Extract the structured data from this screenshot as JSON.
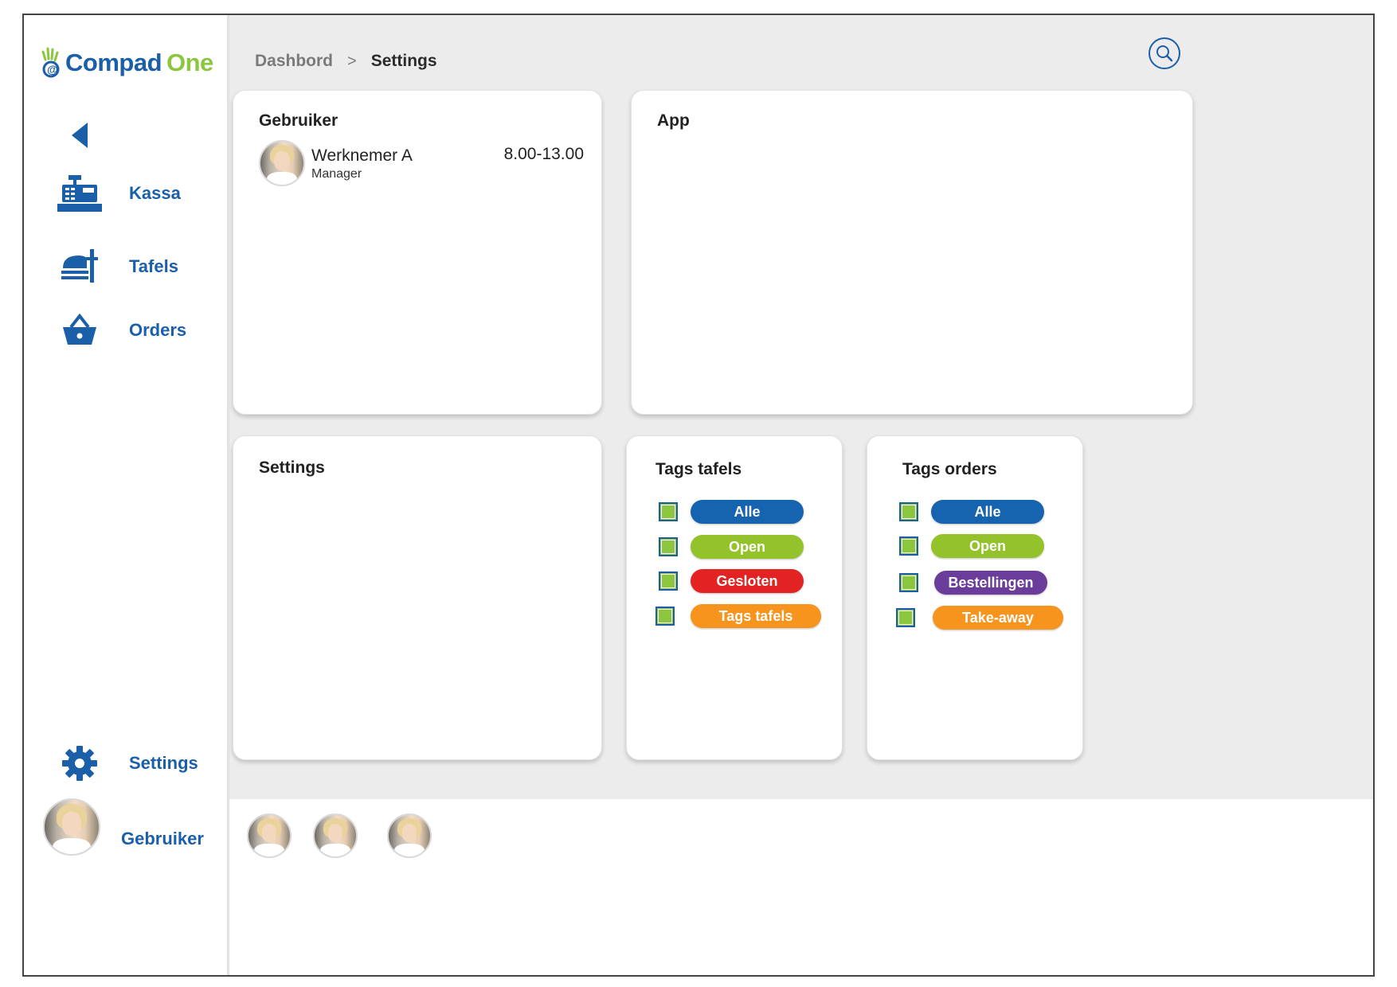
{
  "app": {
    "logo_part1": "Compad",
    "logo_part2": "One",
    "colors": {
      "brand_blue": "#1a5fa8",
      "brand_green": "#8cc63f"
    }
  },
  "sidebar": {
    "back_icon": "back-triangle-icon",
    "items": [
      {
        "label": "Kassa",
        "icon": "cash-register-icon"
      },
      {
        "label": "Tafels",
        "icon": "table-service-icon"
      },
      {
        "label": "Orders",
        "icon": "basket-icon"
      }
    ],
    "settings_label": "Settings",
    "settings_icon": "gear-icon",
    "user_label": "Gebruiker"
  },
  "header": {
    "breadcrumb_home": "Dashbord",
    "breadcrumb_sep": ">",
    "breadcrumb_current": "Settings",
    "search_icon": "search-icon"
  },
  "cards": {
    "gebruiker": {
      "title": "Gebruiker",
      "user_name": "Werknemer A",
      "user_role": "Manager",
      "shift": "8.00-13.00"
    },
    "app": {
      "title": "App"
    },
    "settings": {
      "title": "Settings"
    },
    "tags_tafels": {
      "title": "Tags tafels",
      "tags": [
        {
          "label": "Alle",
          "color": "#1663b0",
          "checked": true
        },
        {
          "label": "Open",
          "color": "#93c22a",
          "checked": true
        },
        {
          "label": "Gesloten",
          "color": "#e32322",
          "checked": true
        },
        {
          "label": "Tags tafels",
          "color": "#f7941d",
          "checked": true
        }
      ]
    },
    "tags_orders": {
      "title": "Tags orders",
      "tags": [
        {
          "label": "Alle",
          "color": "#1663b0",
          "checked": true
        },
        {
          "label": "Open",
          "color": "#93c22a",
          "checked": true
        },
        {
          "label": "Bestellingen",
          "color": "#6a3d9a",
          "checked": true
        },
        {
          "label": "Take-away",
          "color": "#f7941d",
          "checked": true
        }
      ]
    }
  },
  "bottom_bar": {
    "users": [
      "avatar-1",
      "avatar-2",
      "avatar-3"
    ]
  }
}
